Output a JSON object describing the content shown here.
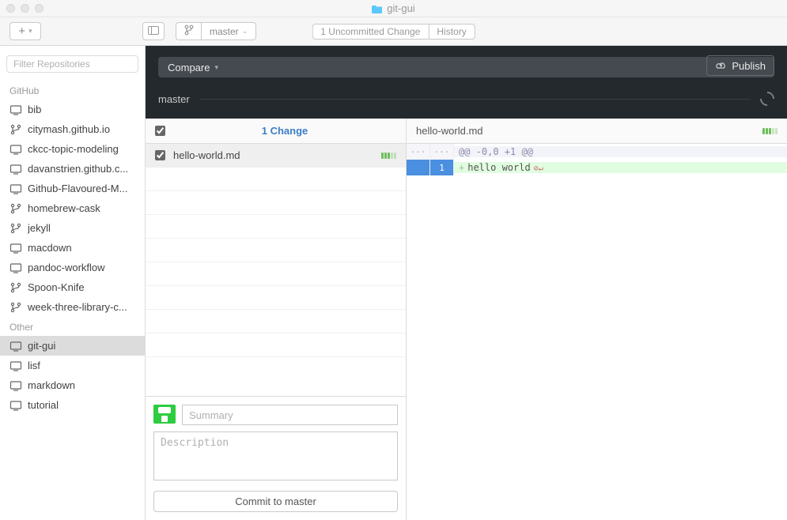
{
  "window": {
    "title": "git-gui"
  },
  "toolbar": {
    "branch_selector": "master",
    "uncommitted_tab": "1 Uncommitted Change",
    "history_tab": "History"
  },
  "sidebar": {
    "filter_placeholder": "Filter Repositories",
    "sections": [
      {
        "title": "GitHub",
        "items": [
          {
            "label": "bib",
            "icon": "monitor"
          },
          {
            "label": "citymash.github.io",
            "icon": "fork"
          },
          {
            "label": "ckcc-topic-modeling",
            "icon": "monitor"
          },
          {
            "label": "davanstrien.github.c...",
            "icon": "monitor"
          },
          {
            "label": "Github-Flavoured-M...",
            "icon": "monitor"
          },
          {
            "label": "homebrew-cask",
            "icon": "fork"
          },
          {
            "label": "jekyll",
            "icon": "fork"
          },
          {
            "label": "macdown",
            "icon": "monitor"
          },
          {
            "label": "pandoc-workflow",
            "icon": "monitor"
          },
          {
            "label": "Spoon-Knife",
            "icon": "fork"
          },
          {
            "label": "week-three-library-c...",
            "icon": "fork"
          }
        ]
      },
      {
        "title": "Other",
        "items": [
          {
            "label": "git-gui",
            "icon": "monitor",
            "selected": true
          },
          {
            "label": "lisf",
            "icon": "monitor"
          },
          {
            "label": "markdown",
            "icon": "monitor"
          },
          {
            "label": "tutorial",
            "icon": "monitor"
          }
        ]
      }
    ]
  },
  "compare": {
    "button_label": "Compare",
    "publish_label": "Publish",
    "branch": "master"
  },
  "changes": {
    "header": "1 Change",
    "files": [
      {
        "name": "hello-world.md",
        "checked": true
      }
    ]
  },
  "commit": {
    "summary_placeholder": "Summary",
    "description_placeholder": "Description",
    "button_label": "Commit to master"
  },
  "diff": {
    "filename": "hello-world.md",
    "hunk": "@@ -0,0 +1 @@",
    "lines": [
      {
        "ln": "1",
        "marker": "+",
        "text": "hello world",
        "type": "add"
      }
    ]
  }
}
